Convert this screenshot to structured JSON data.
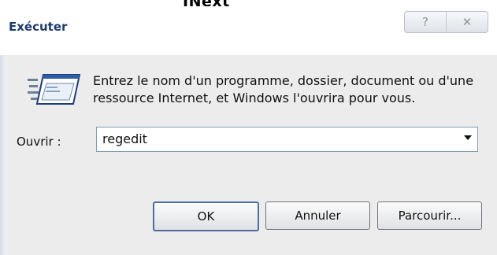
{
  "window": {
    "title": "Exécuter",
    "top_fragment": "INext"
  },
  "caption_buttons": {
    "help_glyph": "?",
    "close_glyph": "✕"
  },
  "dialog": {
    "description": "Entrez le nom d'un programme, dossier, document ou d'une ressource Internet, et Windows l'ouvrira pour vous.",
    "open_label": "Ouvrir :",
    "open_value": "regedit"
  },
  "buttons": {
    "ok": "OK",
    "cancel": "Annuler",
    "browse": "Parcourir..."
  },
  "icons": {
    "run": "run-program-icon",
    "help": "help-icon",
    "close": "close-icon",
    "dropdown": "chevron-down-icon"
  },
  "colors": {
    "title": "#1f3b6e",
    "field_border": "#7f9db9",
    "default_button_border": "#4d6fa0"
  }
}
